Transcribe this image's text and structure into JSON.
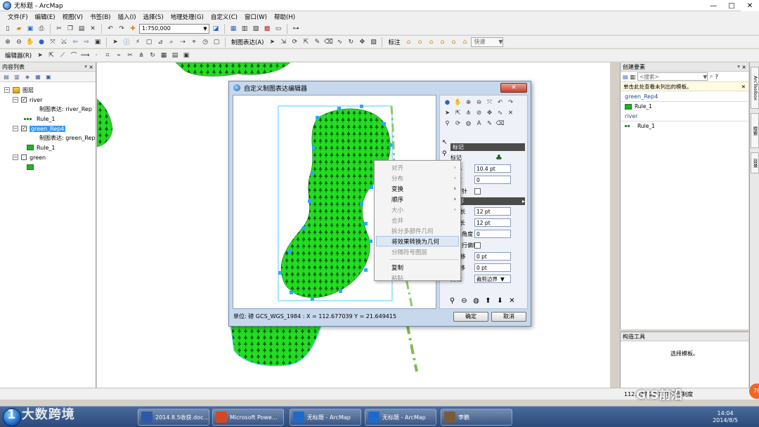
{
  "window": {
    "title": "无标题 - ArcMap",
    "minimize": "—",
    "maximize": "□",
    "close": "✕"
  },
  "menubar": [
    "文件(F)",
    "编辑(E)",
    "视图(V)",
    "书签(B)",
    "插入(I)",
    "选择(S)",
    "地理处理(G)",
    "自定义(C)",
    "窗口(W)",
    "帮助(H)"
  ],
  "toolbar": {
    "scale": "1:750,000",
    "represent_label": "制图表达(A)",
    "label_label": "标注",
    "speed": "快速",
    "editor_label": "编辑器(R)"
  },
  "toc": {
    "header": "内容列表",
    "pin": "ᵠ ×",
    "layers_label": "图层",
    "river": "river",
    "river_rep": "制图表达: river_Rep",
    "river_rule": "Rule_1",
    "green_rep4": "green_Rep4",
    "green_rep4_rep": "制图表达: green_Rep",
    "green_rep4_rule": "Rule_1",
    "green": "green"
  },
  "dialog": {
    "title": "自定义制图表达编辑器",
    "close": "✕",
    "section_marker": "标记",
    "marker_tag": "标记",
    "size_label": "大小",
    "size_value": "10.4 pt",
    "angle_label": "角度",
    "angle_value": "0",
    "clockwise_label": "顺时针",
    "section_inside": "内部",
    "step_x_label": "X步长",
    "step_x_value": "12 pt",
    "step_y_label": "Y步长",
    "step_y_value": "12 pt",
    "grid_angle_label": "网格角度",
    "grid_angle_value": "0",
    "shift_odd_label": "奇数行偏移",
    "offset_x_label": "X偏移",
    "offset_x_value": "0 pt",
    "offset_y_label": "Y偏移",
    "offset_y_value": "0 pt",
    "clip_label": "剪裁",
    "clip_value": "裁剪边界",
    "status": "单位: 磅   GCS_WGS_1984 : X = 112.677039   Y = 21.649415",
    "ok": "确定",
    "cancel": "取消"
  },
  "context_menu": [
    {
      "label": "对齐",
      "sub": "›",
      "disabled": true
    },
    {
      "label": "分布",
      "sub": "›",
      "disabled": true
    },
    {
      "label": "变换",
      "sub": "›",
      "disabled": false
    },
    {
      "label": "顺序",
      "sub": "›",
      "disabled": false
    },
    {
      "label": "大小",
      "sub": "›",
      "disabled": true
    },
    {
      "label": "合并",
      "sub": "",
      "disabled": true
    },
    {
      "label": "拆分多部件几何",
      "sub": "",
      "disabled": true
    },
    {
      "label": "将效果转换为几何",
      "sub": "",
      "disabled": false,
      "hover": true
    },
    {
      "label": "分隔符号图层",
      "sub": "",
      "disabled": true
    },
    {
      "label": "复制",
      "sub": "",
      "disabled": false,
      "sep_before": true
    },
    {
      "label": "粘贴",
      "sub": "",
      "disabled": true
    }
  ],
  "create_features": {
    "header": "创建要素",
    "pin": "ᵠ ×",
    "search_placeholder": "<搜索>",
    "info": "单击此处查看未列出的模板。",
    "info_close": "✕",
    "group1": "green_Rep4",
    "group1_item": "Rule_1",
    "group2": "river",
    "group2_item": "Rule_1"
  },
  "construct_tools": {
    "header": "构造工具",
    "message": "选择模板。"
  },
  "right_tabs": [
    "ArcToolbox",
    "搜索",
    "目录"
  ],
  "statusbar": {
    "coords": "112.377  22.119 十进制度"
  },
  "taskbar": [
    {
      "label": "2014.8.5收获.doc...",
      "color": "#2a5aa8"
    },
    {
      "label": "Microsoft Powe...",
      "color": "#d24726"
    },
    {
      "label": "无标题 - ArcMap",
      "color": "#1e6ac9"
    },
    {
      "label": "无标题 - ArcMap",
      "color": "#1e6ac9"
    },
    {
      "label": "李鹏",
      "color": "#7a5a3a"
    }
  ],
  "clock": {
    "time": "14:04",
    "date": "2014/8/5"
  },
  "watermark_left": "大数跨境",
  "watermark_left_prefix": "1",
  "watermark_right": "GIS前沿",
  "watermark_badge": "78",
  "colors": {
    "polygon_fill": "#22dd22",
    "tree": "#0d5a0d",
    "river": "#7bbf4a",
    "selection": "#55c8ff"
  }
}
